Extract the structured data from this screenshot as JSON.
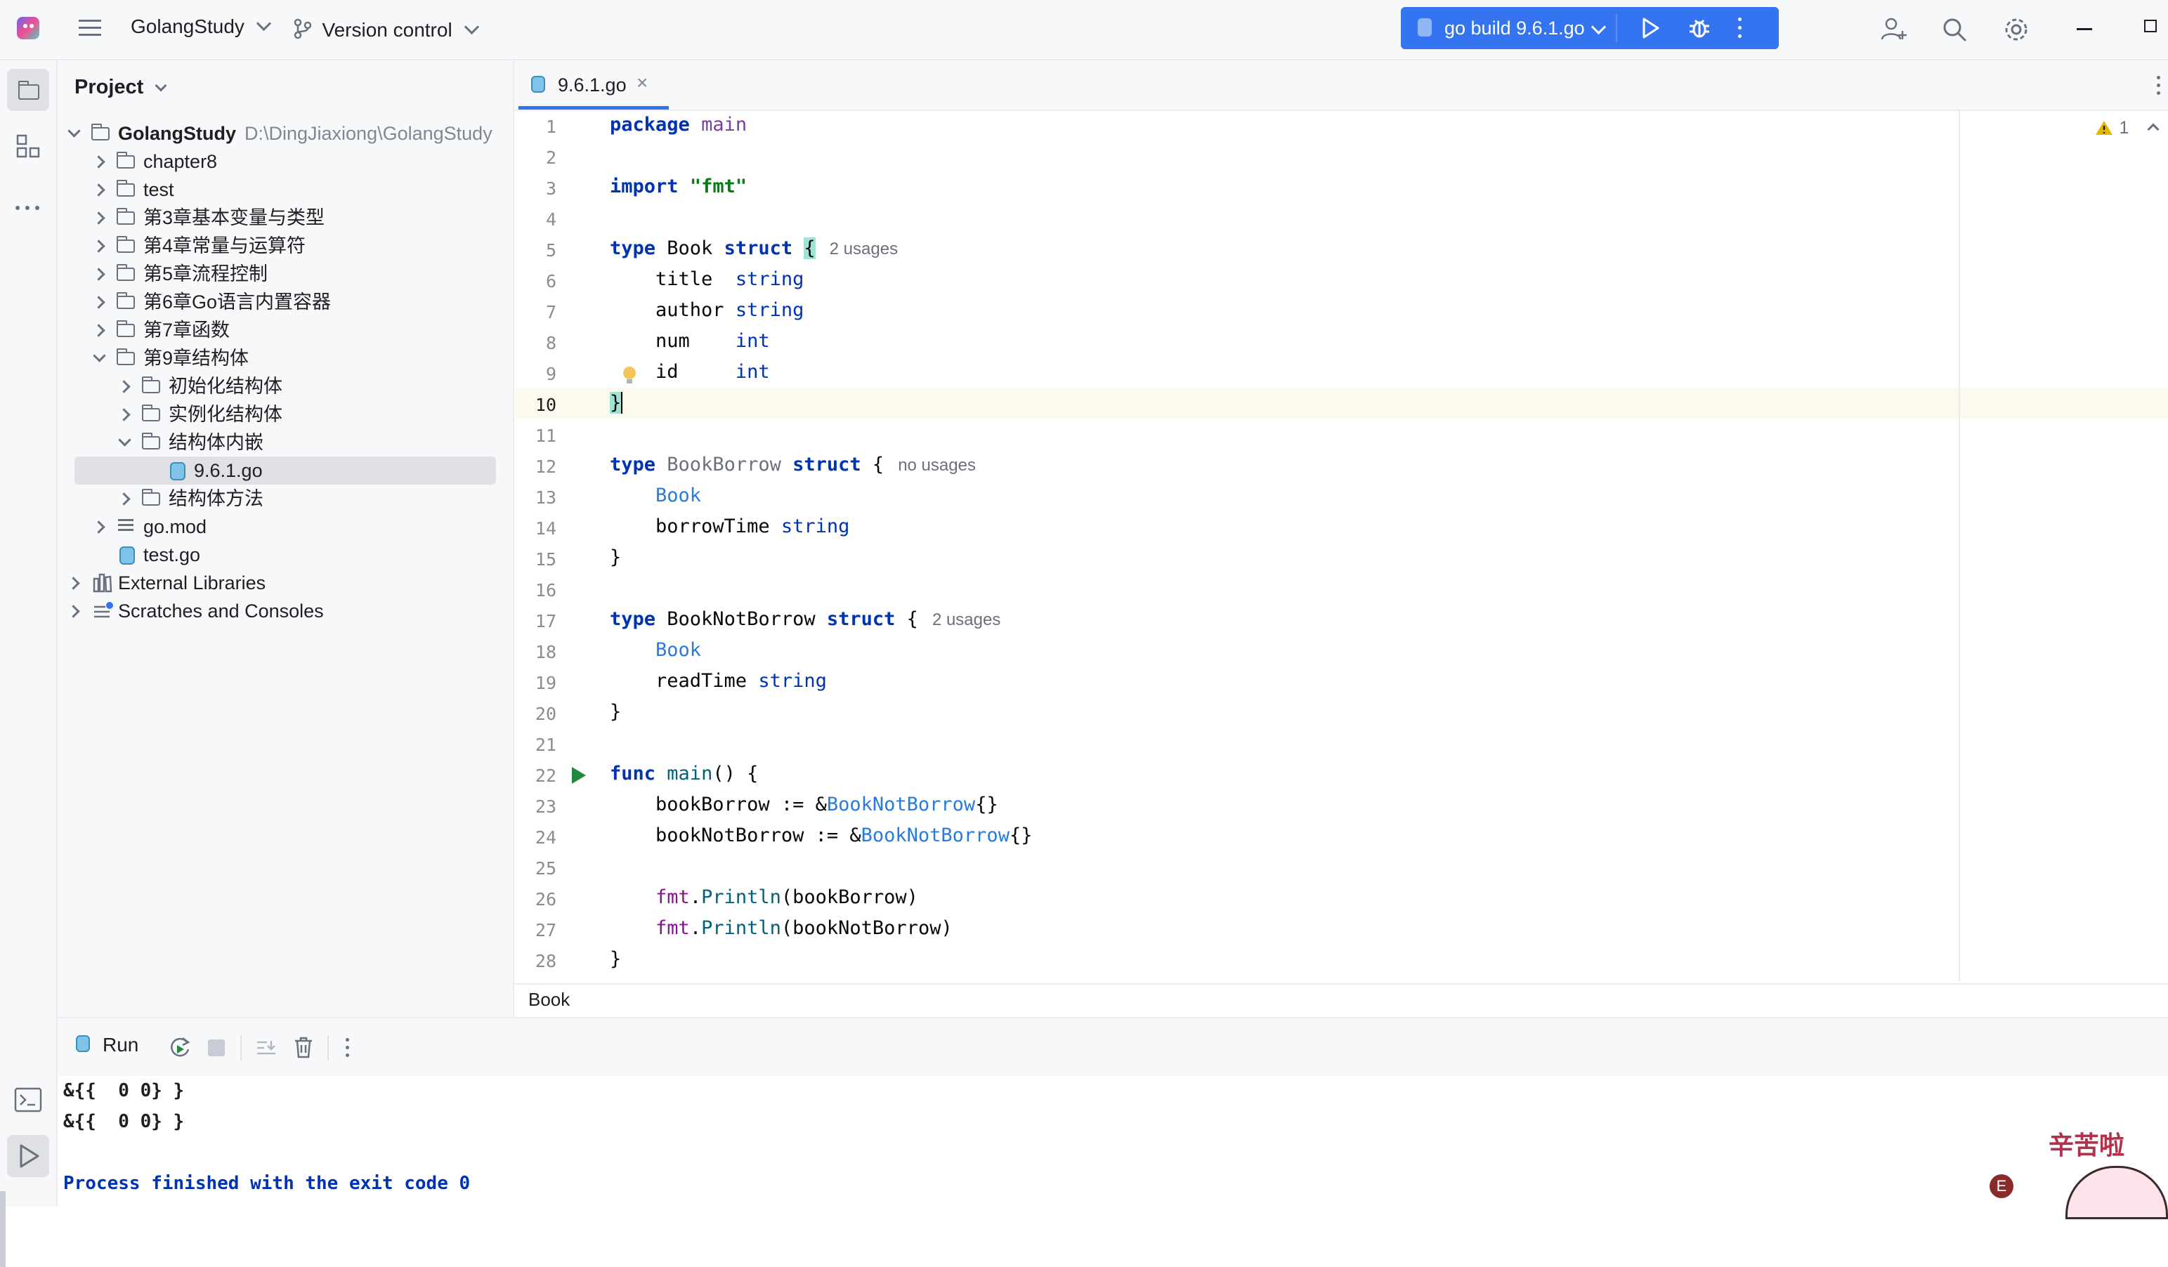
{
  "header": {
    "project_name": "GolangStudy",
    "vcs_label": "Version control",
    "run_config": "go build 9.6.1.go"
  },
  "project_panel": {
    "title": "Project",
    "root_name": "GolangStudy",
    "root_path": "D:\\DingJiaxiong\\GolangStudy",
    "items": [
      {
        "label": "chapter8"
      },
      {
        "label": "test"
      },
      {
        "label": "第3章基本变量与类型"
      },
      {
        "label": "第4章常量与运算符"
      },
      {
        "label": "第5章流程控制"
      },
      {
        "label": "第6章Go语言内置容器"
      },
      {
        "label": "第7章函数"
      },
      {
        "label": "第9章结构体"
      },
      {
        "label": "初始化结构体"
      },
      {
        "label": "实例化结构体"
      },
      {
        "label": "结构体内嵌"
      },
      {
        "label": "9.6.1.go"
      },
      {
        "label": "结构体方法"
      },
      {
        "label": "go.mod"
      },
      {
        "label": "test.go"
      },
      {
        "label": "External Libraries"
      },
      {
        "label": "Scratches and Consoles"
      }
    ]
  },
  "editor": {
    "tab_label": "9.6.1.go",
    "warning_count": "1",
    "breadcrumb": "Book",
    "hints": {
      "book_usages": "2 usages",
      "bookborrow_usages": "no usages",
      "booknotborrow_usages": "2 usages"
    },
    "line_numbers": [
      "1",
      "2",
      "3",
      "4",
      "5",
      "6",
      "7",
      "8",
      "9",
      "10",
      "11",
      "12",
      "13",
      "14",
      "15",
      "16",
      "17",
      "18",
      "19",
      "20",
      "21",
      "22",
      "23",
      "24",
      "25",
      "26",
      "27",
      "28"
    ]
  },
  "run_panel": {
    "tab_label": "Run",
    "output": [
      "&{{  0 0} }",
      "&{{  0 0} }",
      "",
      "Process finished with the exit code 0"
    ]
  },
  "watermark": {
    "text": "辛苦啦"
  },
  "colors": {
    "accent": "#3574f0",
    "keyword": "#0033b3",
    "string": "#067d17",
    "current_line": "#fcfaed",
    "run_green": "#208a3c",
    "warning": "#e5b800"
  }
}
